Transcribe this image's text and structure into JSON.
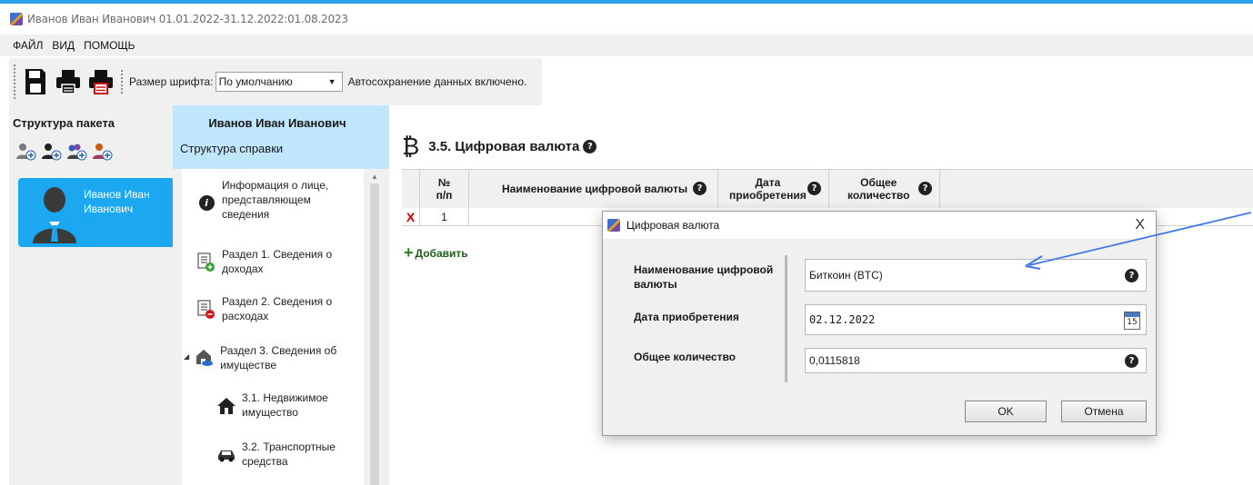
{
  "window": {
    "title": "Иванов Иван Иванович 01.01.2022-31.12.2022:01.08.2023"
  },
  "menu": {
    "items": [
      "ФАЙЛ",
      "ВИД",
      "ПОМОЩЬ"
    ]
  },
  "toolbar": {
    "font_size_label": "Размер шрифта:",
    "font_size_value": "По умолчанию",
    "autosave_text": "Автосохранение данных включено."
  },
  "left_panel": {
    "title": "Структура пакета",
    "person_name_line1": "Иванов Иван",
    "person_name_line2": "Иванович"
  },
  "middle_panel": {
    "person_name": "Иванов Иван Иванович",
    "subtitle": "Структура справки",
    "items": [
      {
        "l1": "Информация о лице,",
        "l2": "представляющем",
        "l3": "сведения"
      },
      {
        "l1": "Раздел 1. Сведения о",
        "l2": "доходах"
      },
      {
        "l1": "Раздел 2. Сведения о",
        "l2": "расходах"
      },
      {
        "l1": "Раздел 3. Сведения об",
        "l2": "имуществе"
      },
      {
        "l1": "3.1. Недвижимое",
        "l2": "имущество"
      },
      {
        "l1": "3.2. Транспортные",
        "l2": "средства"
      }
    ]
  },
  "main": {
    "section_symbol": "₿",
    "section_title": "3.5. Цифровая валюта",
    "columns": {
      "num_l1": "№",
      "num_l2": "п/п",
      "name": "Наименование цифровой валюты",
      "date_l1": "Дата",
      "date_l2": "приобретения",
      "qty_l1": "Общее",
      "qty_l2": "количество"
    },
    "row": {
      "delete": "X",
      "num": "1"
    },
    "add_label": "Добавить",
    "add_symbol": "+"
  },
  "dialog": {
    "title": "Цифровая валюта",
    "close": "X",
    "name_label_l1": "Наименование цифровой",
    "name_label_l2": "валюты",
    "name_value": "Биткоин (BTC)",
    "date_label": "Дата приобретения",
    "date_value": "02.12.2022",
    "calendar_day": "15",
    "qty_label": "Общее количество",
    "qty_value": "0,0115818",
    "ok_label": "OK",
    "cancel_label": "Отмена"
  },
  "help_glyph": "?",
  "colors": {
    "accent": "#1ba8f0",
    "header_bg": "#bfe6fb",
    "arrow": "#3f78e8",
    "delete": "#cc0000"
  }
}
